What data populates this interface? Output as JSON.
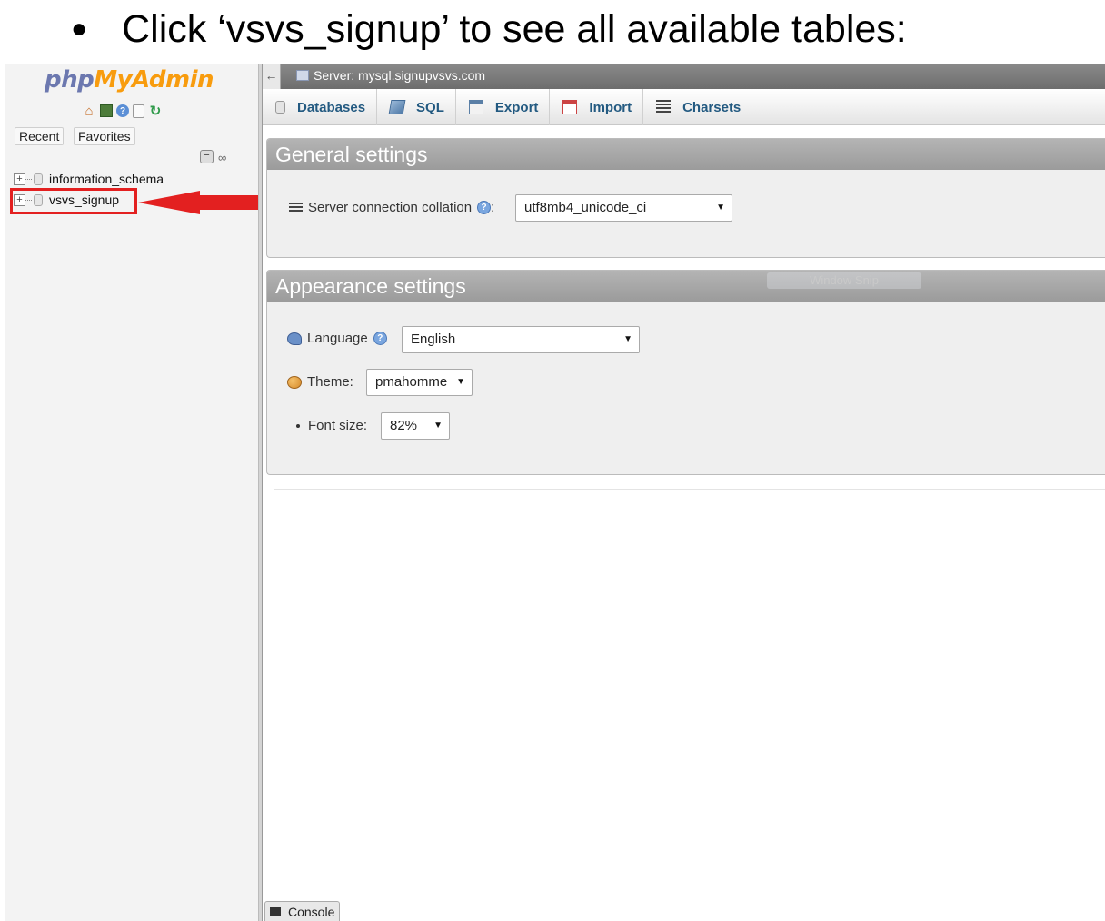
{
  "caption": {
    "bullet": "●",
    "text": "Click ‘vsvs_signup’ to see all available tables:"
  },
  "nav": {
    "logo_php": "php",
    "logo_myadmin": "MyAdmin",
    "tabs": [
      "Recent",
      "Favorites"
    ],
    "databases": [
      {
        "name": "information_schema"
      },
      {
        "name": "vsvs_signup"
      }
    ]
  },
  "serverbar": {
    "title": "Server: mysql.signupvsvs.com"
  },
  "tabs": [
    {
      "label": "Databases",
      "icon": "database-icon"
    },
    {
      "label": "SQL",
      "icon": "sql-icon"
    },
    {
      "label": "Export",
      "icon": "export-icon"
    },
    {
      "label": "Import",
      "icon": "import-icon"
    },
    {
      "label": "Charsets",
      "icon": "charsets-icon"
    }
  ],
  "general_settings": {
    "title": "General settings",
    "collation_label": "Server connection collation",
    "collation_suffix": ":",
    "collation_value": "utf8mb4_unicode_ci"
  },
  "appearance_settings": {
    "title": "Appearance settings",
    "language_label": "Language",
    "language_value": "English",
    "theme_label": "Theme:",
    "theme_value": "pmahomme",
    "font_size_label": "Font size:",
    "font_size_value": "82%"
  },
  "overlay": {
    "window_snip": "Window Snip"
  },
  "console": {
    "label": "Console"
  },
  "colors": {
    "highlight": "#e32020",
    "tab_text": "#235a81",
    "logo_php": "#6c78af",
    "logo_myadmin": "#f89c0e"
  }
}
